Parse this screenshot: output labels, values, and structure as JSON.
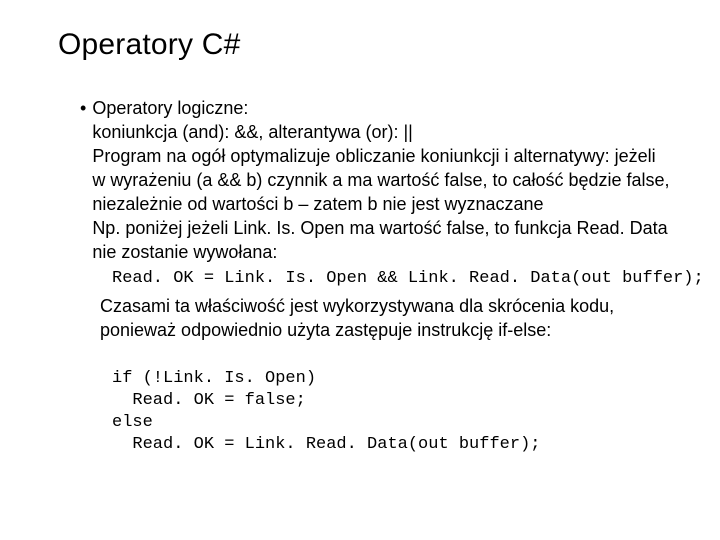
{
  "title": "Operatory C#",
  "bullet": "•",
  "b1_header": "Operatory logiczne:",
  "b1_line1": "koniunkcja (and): &&, alterantywa (or): ||",
  "b1_line2": "Program na ogół optymalizuje obliczanie koniunkcji i alternatywy: jeżeli w wyrażeniu (a && b) czynnik a ma wartość false, to całość będzie false, niezależnie od wartości b – zatem b nie jest wyznaczane",
  "b1_line3": "Np. poniżej jeżeli Link. Is. Open ma wartość false, to funkcja Read. Data nie zostanie wywołana:",
  "code1": "Read. OK = Link. Is. Open && Link. Read. Data(out buffer);",
  "b1_line4": "Czasami ta właściwość jest wykorzystywana dla skrócenia kodu, ponieważ odpowiednio użyta zastępuje instrukcję if-else:",
  "code2_l1": "if (!Link. Is. Open)",
  "code2_l2": "  Read. OK = false;",
  "code2_l3": "else",
  "code2_l4": "  Read. OK = Link. Read. Data(out buffer);"
}
